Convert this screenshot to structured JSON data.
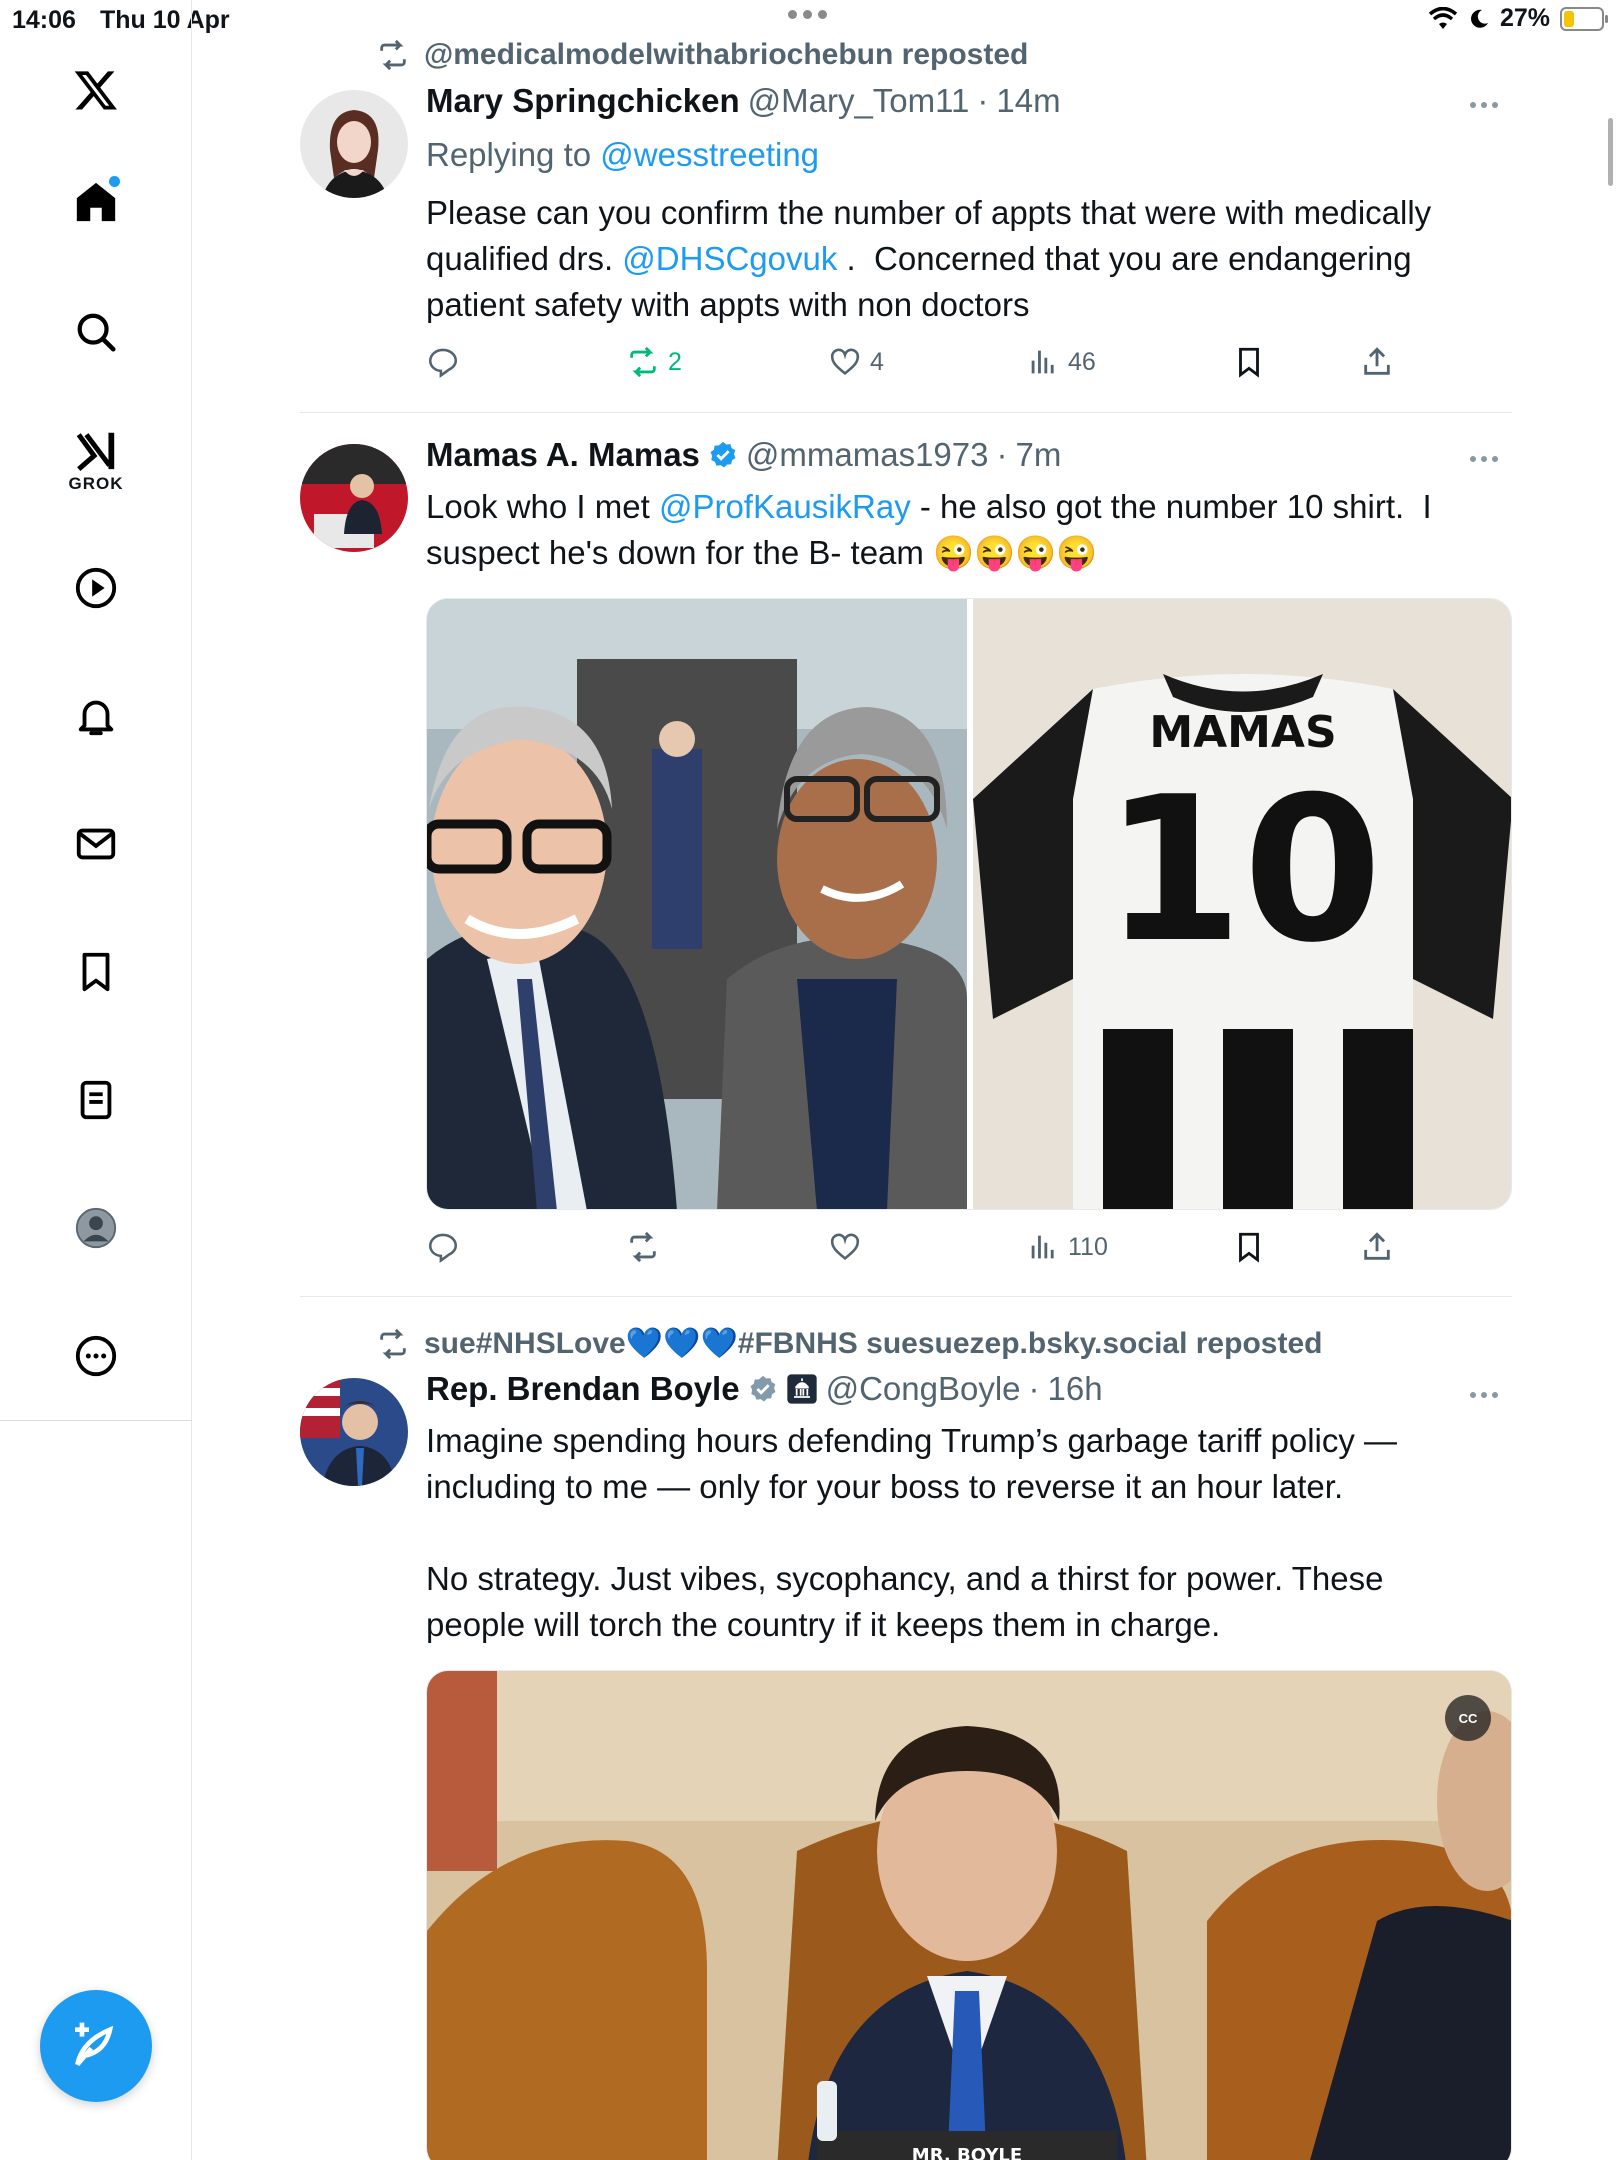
{
  "status_bar": {
    "time": "14:06",
    "date": "Thu 10 Apr",
    "battery": "27%",
    "battery_level": 0.27
  },
  "sidebar": {
    "items": [
      {
        "name": "home",
        "icon": "home-icon",
        "active": true,
        "notification": true
      },
      {
        "name": "search",
        "icon": "search-icon"
      },
      {
        "name": "grok",
        "icon": "grok-icon",
        "label": "GROK"
      },
      {
        "name": "videos",
        "icon": "play-icon"
      },
      {
        "name": "notifications",
        "icon": "bell-icon"
      },
      {
        "name": "messages",
        "icon": "mail-icon"
      },
      {
        "name": "bookmarks",
        "icon": "bookmark-icon"
      },
      {
        "name": "lists",
        "icon": "list-icon"
      },
      {
        "name": "profile",
        "icon": "profile-icon"
      },
      {
        "name": "more",
        "icon": "more-icon"
      }
    ],
    "compose_icon": "compose-icon"
  },
  "colors": {
    "accent": "#1d9bf0",
    "repost_active": "#00ba7c",
    "muted": "#536471"
  },
  "feed": {
    "tweets": [
      {
        "repost_label": "@medicalmodelwithabriochebun reposted",
        "author_name": "Mary Springchicken",
        "handle": "@Mary_Tom11",
        "time": "14m",
        "replying_prefix": "Replying to ",
        "replying_to": "@wesstreeting",
        "text_part1": "Please can you confirm the number of appts that were with medically qualified drs. ",
        "mention": "@DHSCgovuk",
        "text_part2": " .  Concerned that you are endangering patient safety with appts with non doctors",
        "replies": "",
        "reposts": "2",
        "likes": "4",
        "views": "46"
      },
      {
        "author_name": "Mamas A. Mamas",
        "handle": "@mmamas1973",
        "time": "7m",
        "text_part1": "Look who I met ",
        "mention": "@ProfKausikRay",
        "text_part2": " - he also got the number 10 shirt.  I suspect he's down for the B- team 😜😜😜😜",
        "replies": "",
        "reposts": "",
        "likes": "",
        "views": "110",
        "shirt_name": "MAMAS",
        "shirt_number": "10"
      },
      {
        "repost_label": "sue#NHSLove💙💙💙#FBNHS suesuezep.bsky.social reposted",
        "author_name": "Rep. Brendan Boyle",
        "handle": "@CongBoyle",
        "time": "16h",
        "text": "Imagine spending hours defending Trump’s garbage tariff policy — including to me — only for your boss to reverse it an hour later.\n\nNo strategy. Just vibes, sycophancy, and a thirst for power. These people will torch the country if it keeps them in charge.",
        "cc_label": "CC",
        "nameplate": "MR. BOYLE"
      }
    ]
  }
}
